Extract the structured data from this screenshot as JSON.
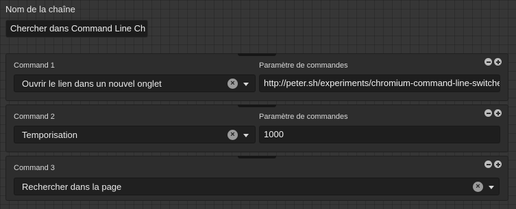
{
  "chain": {
    "label": "Nom de la chaîne",
    "value": "Chercher dans Command Line Ch"
  },
  "commands": [
    {
      "label": "Command 1",
      "param_label": "Paramètre de commandes",
      "selected": "Ouvrir le lien dans un nouvel onglet",
      "param_value": "http://peter.sh/experiments/chromium-command-line-switches/"
    },
    {
      "label": "Command 2",
      "param_label": "Paramètre de commandes",
      "selected": "Temporisation",
      "param_value": "1000"
    },
    {
      "label": "Command 3",
      "selected": "Rechercher dans la page"
    }
  ],
  "icons": {
    "clear": "×",
    "remove": "minus-circle-icon",
    "add": "plus-circle-icon",
    "dropdown": "chevron-down-icon"
  },
  "colors": {
    "background": "#363636",
    "panel": "#2d2d2d",
    "field": "#202020",
    "text": "#e8e8e8"
  }
}
